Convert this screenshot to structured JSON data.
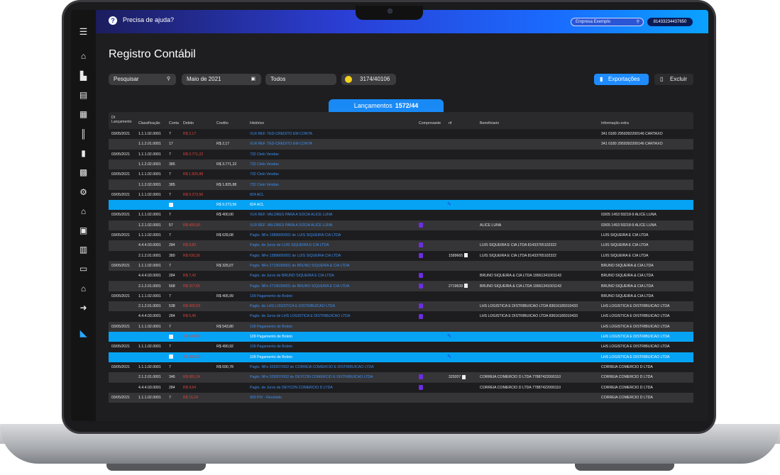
{
  "header": {
    "help_text": "Precisa de ajuda?",
    "company_placeholder": "Empresa Exemplo",
    "cnpj": "81433234437650"
  },
  "page": {
    "title": "Registro Contábil"
  },
  "filters": {
    "search": "Pesquisar",
    "month": "Maio de 2021",
    "status": "Todos",
    "count": "3174/40106"
  },
  "actions": {
    "export": "Exportações",
    "delete": "Excluir"
  },
  "tab": {
    "label": "Lançamentos",
    "count": "1572/44"
  },
  "table": {
    "headers": {
      "dt": "Dt Lançamento",
      "classificacao": "Classificação",
      "conta": "Conta",
      "debito": "Debito",
      "credito": "Credito",
      "historico": "Histórico",
      "comprovante": "Comprovante",
      "nf": "nf",
      "beneficiario": "Beneficiario",
      "info": "Informação extra"
    },
    "rows": [
      {
        "style": "a",
        "dt": "03/05/2021",
        "cl": "1.1.1.02.0001",
        "ct": "7",
        "db": "R$ 2,17",
        "cr": "",
        "hi": "VLR REF. TED-CREDITO EM CONTA",
        "cp": "",
        "nf": "",
        "be": "",
        "in": "341 0180 2959392200146 CARTAXO"
      },
      {
        "style": "b",
        "dt": "",
        "cl": "1.1.2.01.0001",
        "ct": "17",
        "db": "",
        "cr": "R$ 2,17",
        "hi": "VLR REF. TED-CREDITO EM CONTA",
        "cp": "",
        "nf": "",
        "be": "",
        "in": "341 0180 2959392200146 CARTAXO"
      },
      {
        "style": "a",
        "dt": "03/05/2021",
        "cl": "1.1.1.02.0001",
        "ct": "7",
        "db": "R$ 3.771,22",
        "cr": "",
        "hi": "732 Cielo Vendas",
        "cp": "",
        "nf": "",
        "be": "",
        "in": ""
      },
      {
        "style": "b",
        "dt": "",
        "cl": "1.1.2.02.0001",
        "ct": "385",
        "db": "",
        "cr": "R$ 3.771,22",
        "hi": "732 Cielo Vendas",
        "cp": "",
        "nf": "",
        "be": "",
        "in": ""
      },
      {
        "style": "a",
        "dt": "03/05/2021",
        "cl": "1.1.1.02.0001",
        "ct": "7",
        "db": "R$ 1.825,88",
        "cr": "",
        "hi": "732 Cielo Vendas",
        "cp": "",
        "nf": "",
        "be": "",
        "in": ""
      },
      {
        "style": "b",
        "dt": "",
        "cl": "1.1.2.02.0001",
        "ct": "385",
        "db": "",
        "cr": "R$ 1.825,88",
        "hi": "732 Cielo Vendas",
        "cp": "",
        "nf": "",
        "be": "",
        "in": ""
      },
      {
        "style": "a",
        "dt": "03/05/2021",
        "cl": "1.1.1.02.0001",
        "ct": "7",
        "db": "R$ 9.273,56",
        "cr": "",
        "hi": "824 ACL",
        "cp": "",
        "nf": "",
        "be": "",
        "in": ""
      },
      {
        "style": "h",
        "dt": "",
        "cl": "",
        "ct": "sq",
        "db": "",
        "cr": "R$ 9.273,56",
        "hi": "824 ACL",
        "cp": "pen",
        "nf": "",
        "be": "",
        "in": ""
      },
      {
        "style": "a",
        "dt": "03/05/2021",
        "cl": "1.1.1.02.0001",
        "ct": "7",
        "db": "",
        "cr": "R$ 400,00",
        "hi": "VLR REF. VALORES PARA A SOCIA ALICE LUNA",
        "cp": "",
        "nf": "",
        "be": "",
        "in": "03/05 1453 59218-9 ALICE LUNA"
      },
      {
        "style": "b",
        "dt": "",
        "cl": "1.2.1.02.0001",
        "ct": "57",
        "db": "R$ 400,00",
        "cr": "",
        "hi": "VLR REF. VALORES PARA A SOCIA ALICE LUNA",
        "cp": "doc",
        "nf": "",
        "be": "ALICE LUNA",
        "in": "03/05 1453 59218-9 ALICE LUNA"
      },
      {
        "style": "a",
        "dt": "03/05/2021",
        "cl": "1.1.1.02.0001",
        "ct": "7",
        "db": "",
        "cr": "R$ 639,08",
        "hi": "Pagto. NFe 1589665/001 de LUIS SIQUEIRA CIA LTDA",
        "cp": "",
        "nf": "",
        "be": "",
        "in": "LUIS SIQUEIRA E CIA LTDA"
      },
      {
        "style": "b",
        "dt": "",
        "cl": "4.4.4.03.0001",
        "ct": "284",
        "db": "R$ 8,82",
        "cr": "",
        "hi": "Pagto. de Juros de LUIS SIQUEIRA E CIA LTDA",
        "cp": "doc",
        "nf": "",
        "be": "LUIS SIQUEIRA E CIA LTDA 81433765102322",
        "in": "LUIS SIQUEIRA E CIA LTDA"
      },
      {
        "style": "a",
        "dt": "",
        "cl": "2.1.2.01.0001",
        "ct": "380",
        "db": "R$ 630,26",
        "cr": "",
        "hi": "Pagto. NFe 1589665/001 de LUIS SIQUEIRA CIA LTDA",
        "cp": "doc",
        "nf": "1589665",
        "be": "LUIS SIQUEIRA E CIA LTDA 81433765102322",
        "in": "LUIS SIQUEIRA E CIA LTDA"
      },
      {
        "style": "b",
        "dt": "03/05/2021",
        "cl": "1.1.1.02.0001",
        "ct": "7",
        "db": "",
        "cr": "R$ 325,07",
        "hi": "Pagto. NFe 2719639/001 de BRUNO SIQUEIRA & CIA LTDA",
        "cp": "",
        "nf": "",
        "be": "",
        "in": "BRUNO SIQUEIRA & CIA LTDA"
      },
      {
        "style": "a",
        "dt": "",
        "cl": "4.4.4.03.0001",
        "ct": "284",
        "db": "R$ 7,42",
        "cr": "",
        "hi": "Pagto. de Juros de BRUNO SIQUEIRA E CIA LTDA",
        "cp": "doc",
        "nf": "",
        "be": "BRUNO SIQUEIRA & CIA LTDA 19561341001143",
        "in": "BRUNO SIQUEIRA & CIA LTDA"
      },
      {
        "style": "b",
        "dt": "",
        "cl": "2.1.2.01.0001",
        "ct": "568",
        "db": "R$ 317,65",
        "cr": "",
        "hi": "Pagto. NFe 2719639/001 de BRUNO SIQUEIRA E CIA LTDA",
        "cp": "doc",
        "nf": "2719639",
        "be": "BRUNO SIQUEIRA & CIA LTDA 19561341001143",
        "in": "BRUNO SIQUEIRA & CIA LTDA"
      },
      {
        "style": "a",
        "dt": "03/05/2021",
        "cl": "1.1.1.02.0001",
        "ct": "7",
        "db": "",
        "cr": "R$ 405,99",
        "hi": "109 Pagamento de Boleto",
        "cp": "",
        "nf": "",
        "be": "",
        "in": "BRUNO SIQUEIRA & CIA LTDA"
      },
      {
        "style": "b",
        "dt": "",
        "cl": "2.1.2.01.0001",
        "ct": "538",
        "db": "R$ 400,53",
        "cr": "",
        "hi": "Pagto. de LHS LOGISTICA E DISTRIBUICAO LTDA",
        "cp": "doc",
        "nf": "",
        "be": "LHS LOGISTICA E DISTRIBUICAO LTDA 83616185010433",
        "in": "LHS LOGISTICA E DISTRIBUICAO LTDA"
      },
      {
        "style": "a",
        "dt": "",
        "cl": "4.4.4.03.0001",
        "ct": "284",
        "db": "R$ 5,46",
        "cr": "",
        "hi": "Pagto. de Juros de LHS LOGISTICA E DISTRIBUICAO LTDA",
        "cp": "doc",
        "nf": "",
        "be": "LHS LOGISTICA E DISTRIBUICAO LTDA 83616185010433",
        "in": "LHS LOGISTICA E DISTRIBUICAO LTDA"
      },
      {
        "style": "b",
        "dt": "03/05/2021",
        "cl": "1.1.1.02.0001",
        "ct": "7",
        "db": "",
        "cr": "R$ 543,80",
        "hi": "109 Pagamento de Boleto",
        "cp": "",
        "nf": "",
        "be": "",
        "in": "LHS LOGISTICA E DISTRIBUICAO LTDA"
      },
      {
        "style": "h",
        "dt": "",
        "cl": "",
        "ct": "sq",
        "db": "R$ 543,80",
        "cr": "",
        "hi": "109 Pagamento de Boleto",
        "cp": "pen",
        "nf": "",
        "be": "",
        "in": "LHS LOGISTICA E DISTRIBUICAO LTDA"
      },
      {
        "style": "a",
        "dt": "03/05/2021",
        "cl": "1.1.1.02.0001",
        "ct": "7",
        "db": "",
        "cr": "R$ 490,92",
        "hi": "109 Pagamento de Boleto",
        "cp": "",
        "nf": "",
        "be": "",
        "in": "LHS LOGISTICA E DISTRIBUICAO LTDA"
      },
      {
        "style": "h",
        "dt": "",
        "cl": "",
        "ct": "sq",
        "db": "R$ 490,92",
        "cr": "",
        "hi": "109 Pagamento de Boleto",
        "cp": "pen",
        "nf": "",
        "be": "",
        "in": "LHS LOGISTICA E DISTRIBUICAO LTDA"
      },
      {
        "style": "a",
        "dt": "03/05/2021",
        "cl": "1.1.1.02.0001",
        "ct": "7",
        "db": "",
        "cr": "R$ 690,78",
        "hi": "Pagto. NFe 329207/002 de CORREIA COMERCIO E DISTRIBUICAO LTDA",
        "cp": "",
        "nf": "",
        "be": "",
        "in": "CORREIA COMERCIO D LTDA"
      },
      {
        "style": "b",
        "dt": "",
        "cl": "2.1.2.01.0001",
        "ct": "346",
        "db": "R$ 681,24",
        "cr": "",
        "hi": "Pagto. NFe 329207/002 de DEYCON COMERCIO E DISTRIBUICAO LTDA",
        "cp": "doc",
        "nf": "329207",
        "be": "CORREIA COMERCIO D LTDA 77887422000110",
        "in": "CORREIA COMERCIO D LTDA"
      },
      {
        "style": "a",
        "dt": "",
        "cl": "4.4.4.03.0001",
        "ct": "284",
        "db": "R$ 9,54",
        "cr": "",
        "hi": "Pagto. de Juros de DEYCON COMERCIO D LTDA",
        "cp": "doc",
        "nf": "",
        "be": "CORREIA COMERCIO D LTDA 77887422000110",
        "in": "CORREIA COMERCIO D LTDA"
      },
      {
        "style": "b",
        "dt": "03/05/2021",
        "cl": "1.1.1.02.0001",
        "ct": "7",
        "db": "R$ 15,24",
        "cr": "",
        "hi": "900 PIX - Recebido",
        "cp": "",
        "nf": "",
        "be": "",
        "in": "CORREIA COMERCIO D LTDA"
      }
    ]
  },
  "sidebar": {
    "icons": [
      "menu-icon",
      "home-icon",
      "chart-icon",
      "book-icon",
      "document-icon",
      "barcode-icon",
      "file-icon",
      "file-chart-icon",
      "gears-icon",
      "bank-icon",
      "clipboard-icon",
      "building-icon",
      "card-icon",
      "unlock-icon",
      "logout-icon",
      "logo-icon"
    ]
  }
}
